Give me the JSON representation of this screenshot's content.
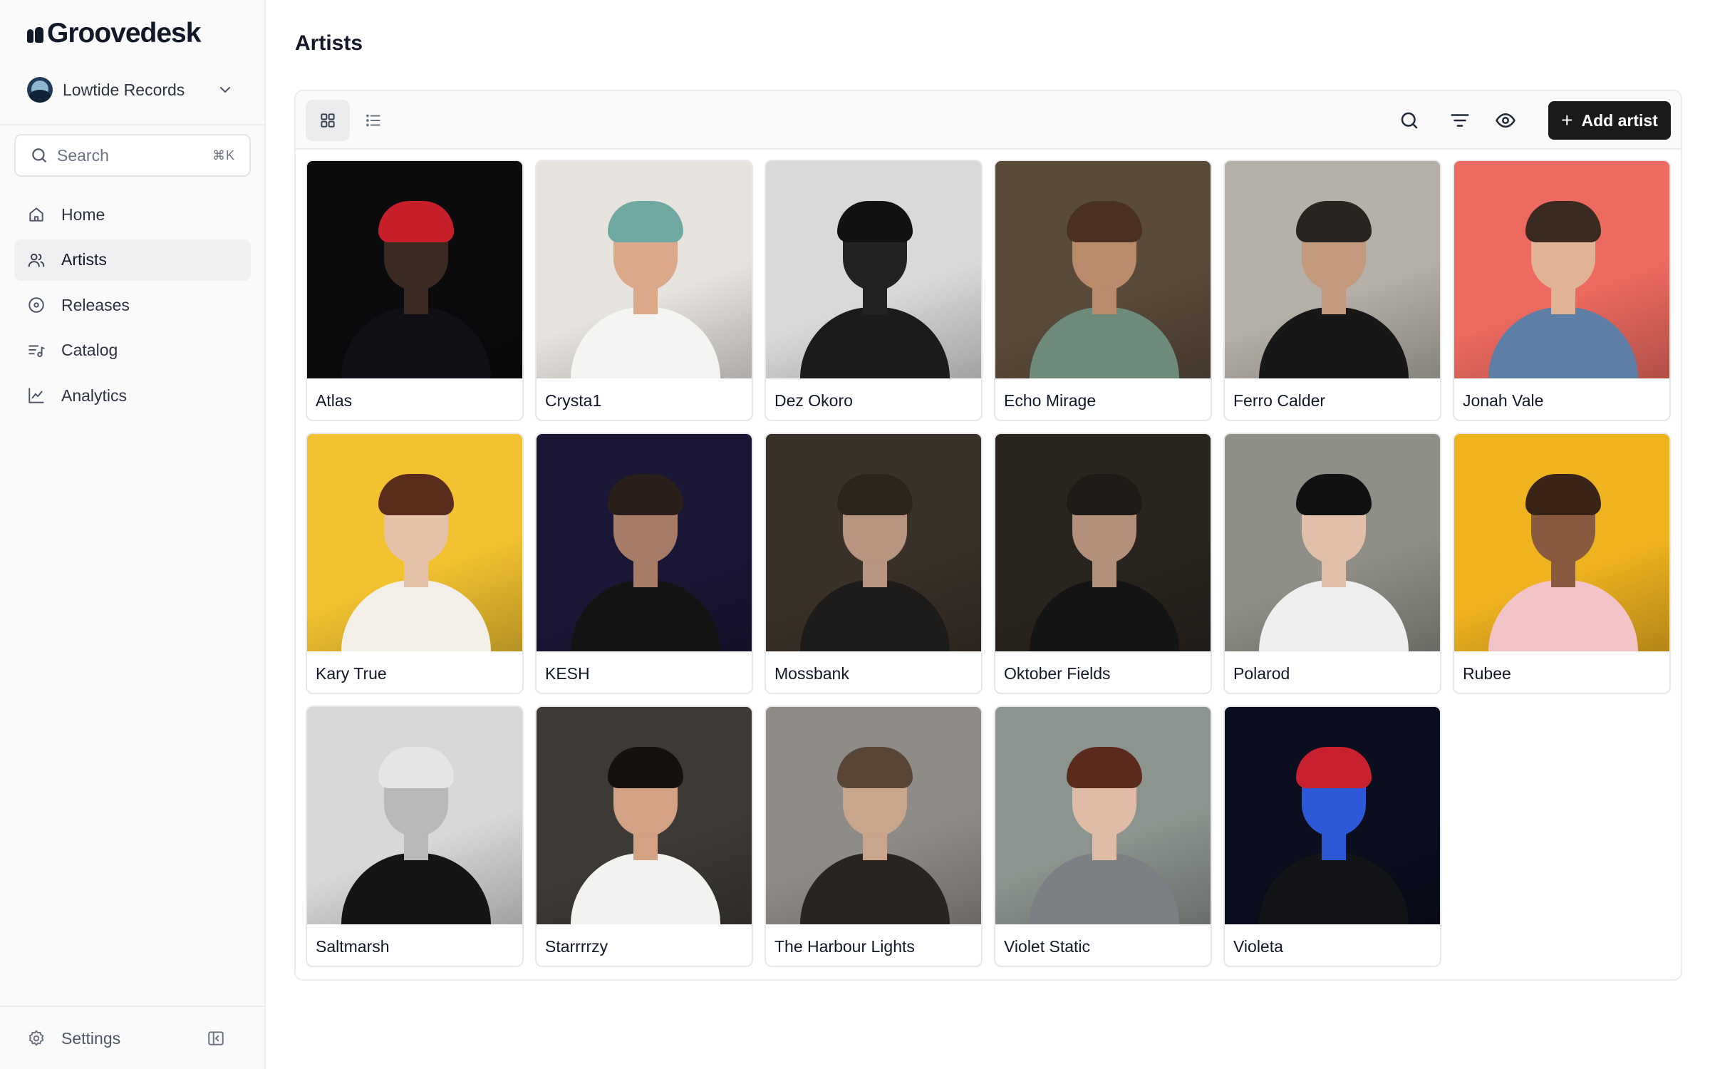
{
  "app": {
    "name": "Groovedesk",
    "workspace": "Lowtide Records"
  },
  "sidebar": {
    "search": {
      "placeholder": "Search",
      "shortcut": "⌘K"
    },
    "items": [
      {
        "label": "Home",
        "icon": "home-icon",
        "active": false
      },
      {
        "label": "Artists",
        "icon": "users-icon",
        "active": true
      },
      {
        "label": "Releases",
        "icon": "disc-icon",
        "active": false
      },
      {
        "label": "Catalog",
        "icon": "catalog-icon",
        "active": false
      },
      {
        "label": "Analytics",
        "icon": "chart-icon",
        "active": false
      }
    ],
    "settings_label": "Settings"
  },
  "main": {
    "title": "Artists",
    "add_button_label": "Add artist",
    "view_mode": "grid",
    "artists": [
      {
        "name": "Atlas",
        "photo": {
          "bg": "#0b0b0d",
          "skin": "#3a2a22",
          "hair": "#c8202a",
          "shirt": "#101016"
        }
      },
      {
        "name": "Crysta1",
        "photo": {
          "bg": "#e7e4df",
          "skin": "#d9a98a",
          "hair": "#6fa9a2",
          "shirt": "#f4f4f2"
        }
      },
      {
        "name": "Dez Okoro",
        "photo": {
          "bg": "#d9d9d9",
          "skin": "#222222",
          "hair": "#111111",
          "shirt": "#1b1b1b"
        }
      },
      {
        "name": "Echo Mirage",
        "photo": {
          "bg": "#5a4a3a",
          "skin": "#b98b6b",
          "hair": "#4a3024",
          "shirt": "#6d8a7a"
        }
      },
      {
        "name": "Ferro Calder",
        "photo": {
          "bg": "#b4afa7",
          "skin": "#c49a7c",
          "hair": "#2a2420",
          "shirt": "#171717"
        }
      },
      {
        "name": "Jonah Vale",
        "photo": {
          "bg": "#ec6a60",
          "skin": "#e0b396",
          "hair": "#3a2a20",
          "shirt": "#5d7fa6"
        }
      },
      {
        "name": "Kary True",
        "photo": {
          "bg": "#f2c230",
          "skin": "#e6c2a8",
          "hair": "#5a2c1c",
          "shirt": "#f3efe8"
        }
      },
      {
        "name": "KESH",
        "photo": {
          "bg": "#1a1635",
          "skin": "#a67c66",
          "hair": "#2a1e1a",
          "shirt": "#141414"
        }
      },
      {
        "name": "Mossbank",
        "photo": {
          "bg": "#3a3128",
          "skin": "#b89580",
          "hair": "#2d241c",
          "shirt": "#1d1b1a"
        }
      },
      {
        "name": "Oktober Fields",
        "photo": {
          "bg": "#2a241e",
          "skin": "#b4907a",
          "hair": "#1e1a16",
          "shirt": "#141414"
        }
      },
      {
        "name": "Polarod",
        "photo": {
          "bg": "#8f8f87",
          "skin": "#e2bfa8",
          "hair": "#111111",
          "shirt": "#eeeeee"
        }
      },
      {
        "name": "Rubee",
        "photo": {
          "bg": "#f0b320",
          "skin": "#8a5a3e",
          "hair": "#3a2418",
          "shirt": "#f2c4c8"
        }
      },
      {
        "name": "Saltmarsh",
        "photo": {
          "bg": "#d8d8d8",
          "skin": "#b9b9b9",
          "hair": "#e6e6e6",
          "shirt": "#151515"
        }
      },
      {
        "name": "Starrrrzy",
        "photo": {
          "bg": "#3d3a36",
          "skin": "#d3a184",
          "hair": "#14110f",
          "shirt": "#f2f2f0"
        }
      },
      {
        "name": "The Harbour Lights",
        "photo": {
          "bg": "#8f8c88",
          "skin": "#c9a58c",
          "hair": "#5a4636",
          "shirt": "#2a2420"
        }
      },
      {
        "name": "Violet Static",
        "photo": {
          "bg": "#8c948f",
          "skin": "#e0bba6",
          "hair": "#5a2a1c",
          "shirt": "#7c7f84"
        }
      },
      {
        "name": "Violeta",
        "photo": {
          "bg": "#0a0e1e",
          "skin": "#2c58d8",
          "hair": "#c8202c",
          "shirt": "#121418"
        }
      }
    ]
  }
}
